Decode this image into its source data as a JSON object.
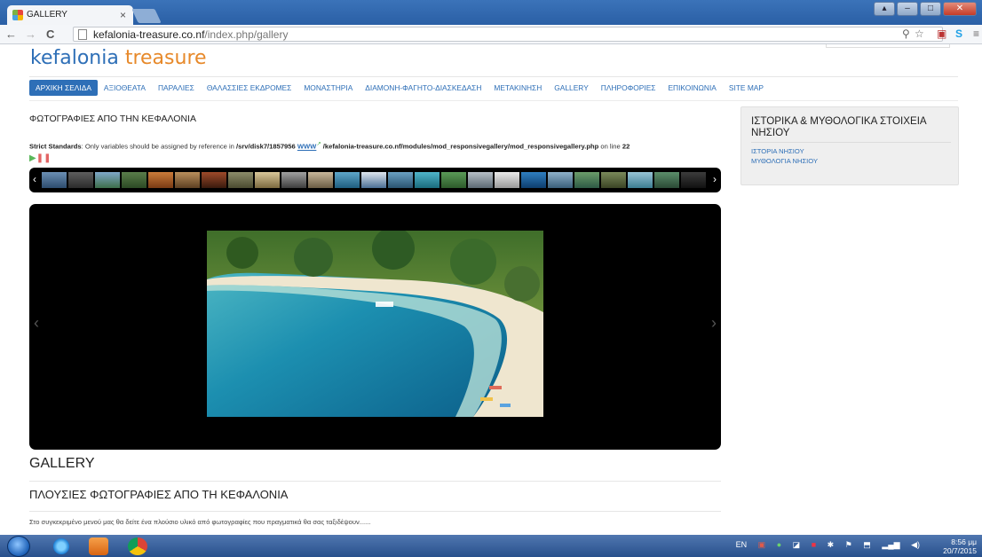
{
  "browser": {
    "tab_title": "GALLERY",
    "tab_close": "×",
    "url_host": "kefalonia-treasure.co.nf",
    "url_path": "/index.php/gallery"
  },
  "site": {
    "logo_part1": "kefalonia ",
    "logo_part2": "treasure"
  },
  "menu": {
    "items": [
      "ΑΡΧΙΚΗ ΣΕΛΙΔΑ",
      "ΑΞΙΟΘΕΑΤΑ",
      "ΠΑΡΑΛΙΕΣ",
      "ΘΑΛΑΣΣΙΕΣ ΕΚΔΡΟΜΕΣ",
      "ΜΟΝΑΣΤΗΡΙΑ",
      "ΔΙΑΜΟΝΗ-ΦΑΓΗΤΟ-ΔΙΑΣΚΕΔΑΣΗ",
      "ΜΕΤΑΚΙΝΗΣΗ",
      "GALLERY",
      "ΠΛΗΡΟΦΟΡΙΕΣ",
      "ΕΠΙΚΟΙΝΩΝΙΑ",
      "SITE MAP"
    ],
    "active_index": 0
  },
  "main": {
    "photos_title": "ΦΩΤΟΓΡΑΦΙΕΣ ΑΠΟ ΤΗΝ ΚΕΦΑΛΟΝΙΑ",
    "strict_label": "Strict Standards",
    "strict_text": ": Only variables should be assigned by reference in ",
    "strict_path1": "/srv/disk7/1857956",
    "strict_www": "WWW",
    "strict_path2": " /kefalonia-treasure.co.nf/modules/mod_responsivegallery/mod_responsivegallery.php",
    "strict_online": " on line ",
    "strict_line": "22",
    "gallery_heading": "GALLERY",
    "sub_heading": "ΠΛΟΥΣΙΕΣ ΦΩΤΟΓΡΑΦΙΕΣ ΑΠΟ ΤΗ ΚΕΦΑΛΟΝΙΑ",
    "description": "Στο συγκεκριμένο μενού μας θα δείτε ένα πλούσιο υλικό από φωτογραφίες που πραγματικά θα σας ταξιδέψουν......"
  },
  "sidebar": {
    "title": "ΙΣΤΟΡΙΚΑ & ΜΥΘΟΛΟΓΙΚΑ ΣΤΟΙΧΕΙΑ ΝΗΣΙΟΥ",
    "links": [
      "ΙΣΤΟΡΙΑ ΝΗΣΙΟΥ",
      "ΜΥΘΟΛΟΓΙΑ ΝΗΣΙΟΥ"
    ]
  },
  "taskbar": {
    "lang": "EN",
    "time": "8:56 μμ",
    "date": "20/7/2015"
  },
  "colors": {
    "link_blue": "#2e6fb7",
    "logo_orange": "#e7892a"
  }
}
